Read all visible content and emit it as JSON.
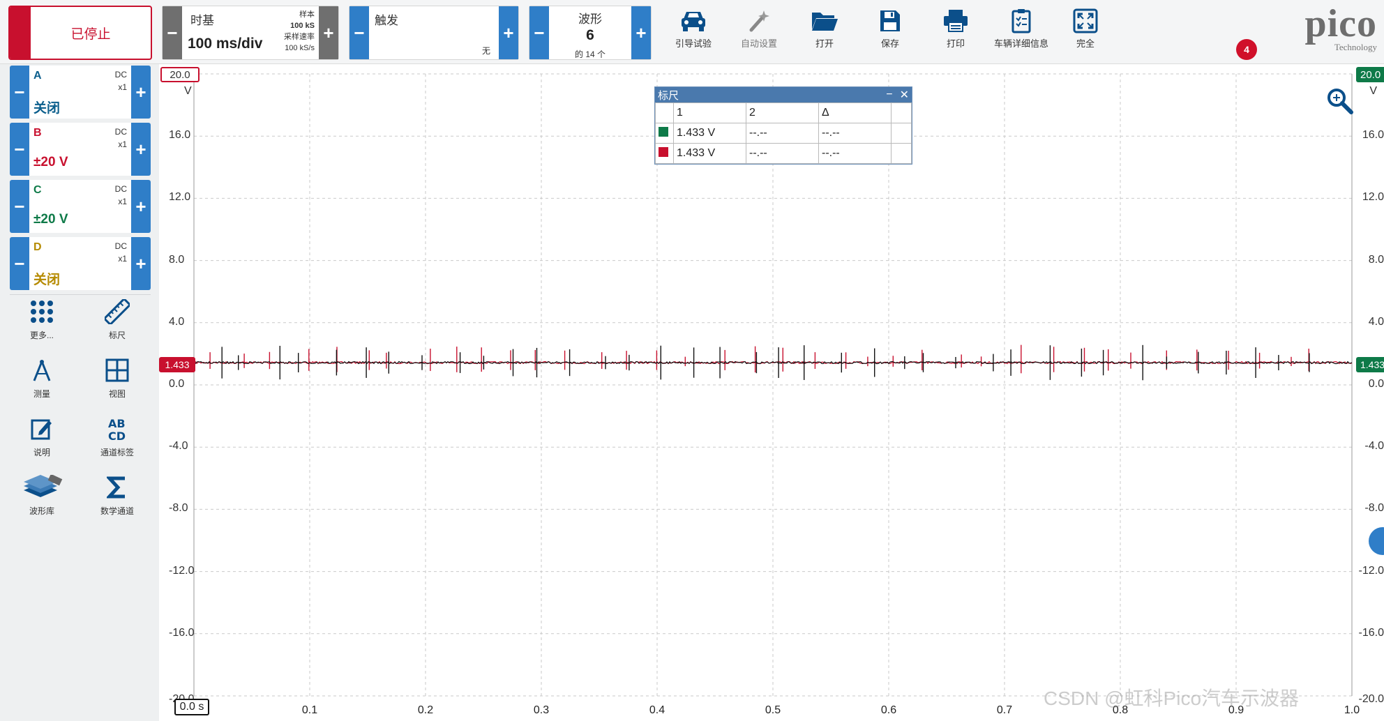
{
  "toolbar": {
    "stop_label": "已停止",
    "timebase": {
      "label": "时基",
      "value": "100 ms/div",
      "samples_label": "样本",
      "samples_value": "100 kS",
      "rate_label": "采样速率",
      "rate_value": "100 kS/s"
    },
    "trigger": {
      "label": "触发",
      "mode": "无"
    },
    "waveform": {
      "label": "波形",
      "number": "6",
      "total": "的 14 个"
    },
    "tools": [
      {
        "label": "引导试验",
        "icon": "car-icon"
      },
      {
        "label": "自动设置",
        "icon": "magic-wand-icon"
      },
      {
        "label": "打开",
        "icon": "folder-open-icon"
      },
      {
        "label": "保存",
        "icon": "save-icon"
      },
      {
        "label": "打印",
        "icon": "printer-icon"
      },
      {
        "label": "车辆详细信息",
        "icon": "clipboard-icon"
      },
      {
        "label": "完全",
        "icon": "fullscreen-icon"
      }
    ],
    "notification_count": "4",
    "logo_text": "pico",
    "logo_sub": "Technology"
  },
  "channels": [
    {
      "name": "A",
      "coupling": "DC",
      "probe": "x1",
      "range": "关闭",
      "color": "#0b5e8c",
      "range_color": "#0b5e8c"
    },
    {
      "name": "B",
      "coupling": "DC",
      "probe": "x1",
      "range": "±20 V",
      "color": "#c8102e",
      "range_color": "#c8102e"
    },
    {
      "name": "C",
      "coupling": "DC",
      "probe": "x1",
      "range": "±20 V",
      "color": "#0e7a48",
      "range_color": "#0e7a48"
    },
    {
      "name": "D",
      "coupling": "DC",
      "probe": "x1",
      "range": "关闭",
      "color": "#b58a00",
      "range_color": "#b58a00"
    }
  ],
  "side_tools": [
    {
      "label": "更多...",
      "icon": "dots-grid-icon"
    },
    {
      "label": "标尺",
      "icon": "ruler-icon"
    },
    {
      "label": "测量",
      "icon": "compass-icon"
    },
    {
      "label": "视图",
      "icon": "grid-view-icon"
    },
    {
      "label": "说明",
      "icon": "notes-icon"
    },
    {
      "label": "通道标签",
      "icon": "channel-labels-icon"
    },
    {
      "label": "波形库",
      "icon": "waveform-library-icon"
    },
    {
      "label": "数学通道",
      "icon": "sigma-icon"
    }
  ],
  "ruler_window": {
    "title": "标尺",
    "headers": [
      "",
      "1",
      "2",
      "Δ"
    ],
    "rows": [
      {
        "color": "#0e7a48",
        "v1": "1.433 V",
        "v2": "--.--",
        "delta": "--.--"
      },
      {
        "color": "#c8102e",
        "v1": "1.433 V",
        "v2": "--.--",
        "delta": "--.--"
      }
    ]
  },
  "markers": {
    "top_left": "20.0",
    "top_right": "20.0",
    "level_left": "1.433",
    "level_right": "1.433",
    "time_origin": "0.0 s",
    "bottom_left": "-20.0",
    "bottom_right": "-20.0"
  },
  "watermark": "CSDN @虹科Pico汽车示波器",
  "chart_data": {
    "type": "line",
    "title": "",
    "xlabel": "",
    "ylabel": "V",
    "xlim": [
      0,
      1.0
    ],
    "ylim": [
      -20,
      20
    ],
    "grid": true,
    "x_ticks": [
      "0.1",
      "0.2",
      "0.3",
      "0.4",
      "0.5",
      "0.6",
      "0.7",
      "0.8",
      "0.9",
      "1.0"
    ],
    "y_ticks": [
      20,
      16,
      12,
      8,
      4,
      0,
      -4,
      -8,
      -12,
      -16,
      -20
    ],
    "y_ticks_left": [
      "16.0",
      "12.0",
      "8.0",
      "4.0",
      "0.0",
      "-4.0",
      "-8.0",
      "-12.0",
      "-16.0"
    ],
    "y_ticks_right": [
      "16.0",
      "12.0",
      "8.0",
      "4.0",
      "0.0",
      "-4.0",
      "-8.0",
      "-12.0",
      "-16.0"
    ],
    "series": [
      {
        "name": "B",
        "color": "#c8102e",
        "baseline": 1.433
      },
      {
        "name": "C",
        "color": "#111111",
        "baseline": 1.433
      }
    ]
  }
}
